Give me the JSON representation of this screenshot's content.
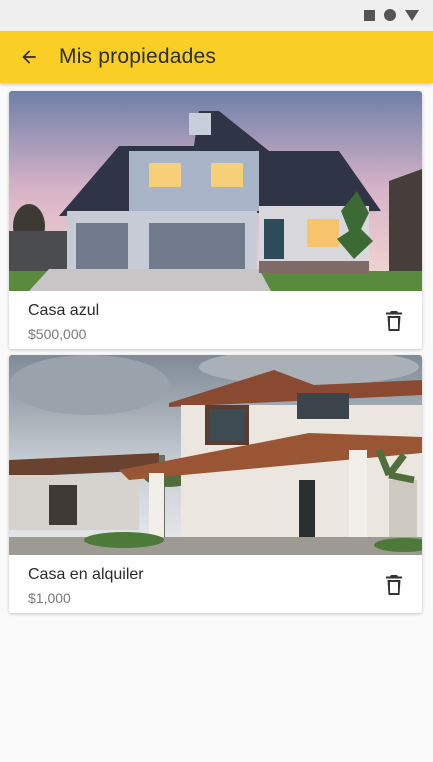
{
  "app_bar": {
    "title": "Mis propiedades",
    "back_icon": "arrow-back-icon",
    "color": "#f9cf25"
  },
  "status_bar": {
    "icons": [
      "square-icon",
      "circle-icon",
      "triangle-icon"
    ]
  },
  "properties": [
    {
      "name": "Casa azul",
      "price": "$500,000",
      "image": "house-photo-blue",
      "delete_icon": "trash-icon"
    },
    {
      "name": "Casa en alquiler",
      "price": "$1,000",
      "image": "house-photo-white",
      "delete_icon": "trash-icon"
    }
  ]
}
